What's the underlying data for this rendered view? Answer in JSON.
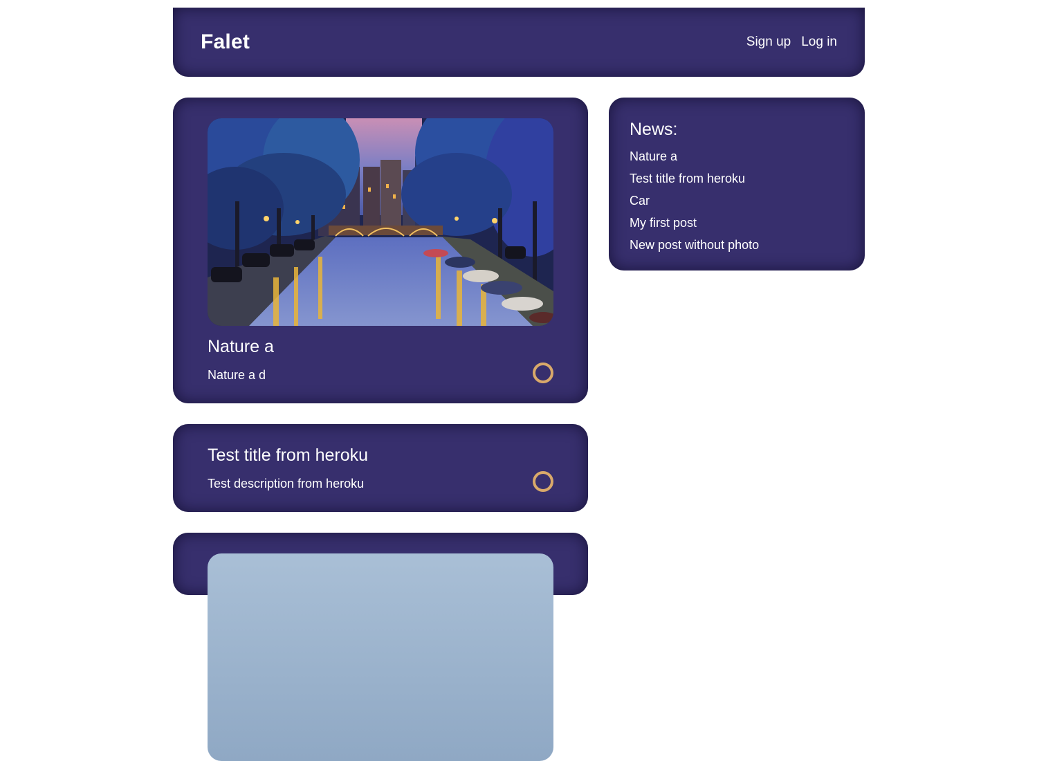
{
  "header": {
    "logo": "Falet",
    "nav": {
      "signup_label": "Sign up",
      "login_label": "Log in"
    }
  },
  "posts": [
    {
      "title": "Nature a",
      "description": "Nature a d",
      "has_photo": true
    },
    {
      "title": "Test title from heroku",
      "description": "Test description from heroku",
      "has_photo": false
    },
    {
      "has_photo": true
    }
  ],
  "news": {
    "heading": "News:",
    "items": [
      "Nature a",
      "Test title from heroku",
      "Car",
      "My first post",
      "New post without photo"
    ]
  },
  "colors": {
    "card_background": "#372f6d",
    "like_ring": "#d9a96a",
    "text": "#ffffff",
    "page_background": "#ffffff"
  },
  "icons": {
    "like": "like-ring-icon"
  }
}
